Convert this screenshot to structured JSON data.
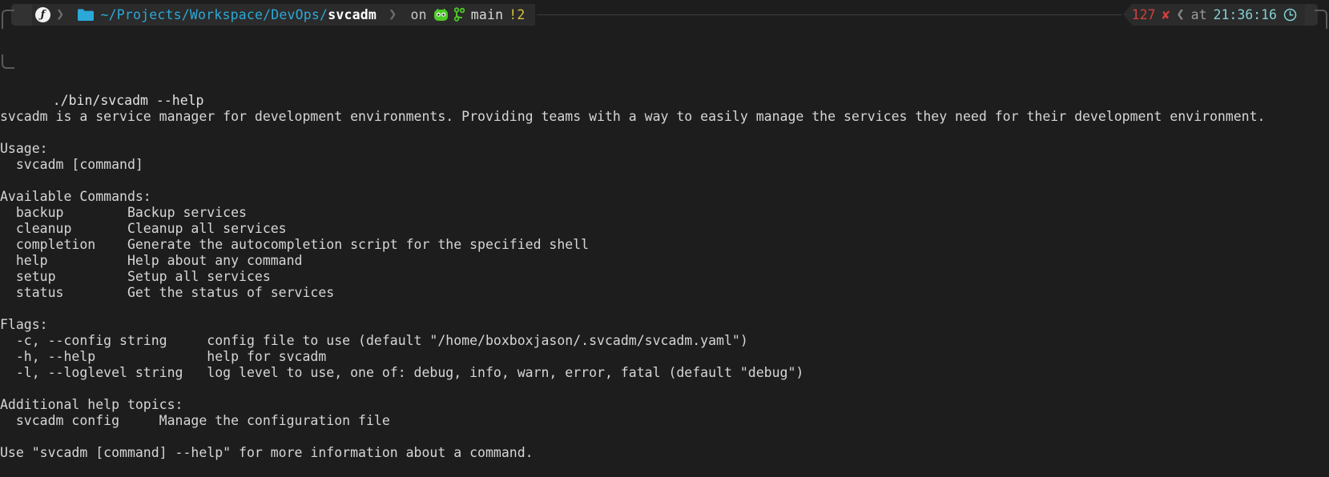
{
  "prompt": {
    "shell_icon": "fish-icon",
    "shell_glyph": "ƒ",
    "folder_icon": "folder-icon",
    "path_prefix": "~/Projects/Workspace/DevOps/",
    "path_current": "svcadm",
    "on_label": "on",
    "host_icon": "octocat-icon",
    "branch_icon": "git-branch-icon",
    "branch_name": "main",
    "git_status": "!2",
    "exit_code": "127",
    "exit_mark": "✘",
    "at_label": "at",
    "time": "21:36:16",
    "clock_icon": "clock-icon",
    "chevron": "❯",
    "chevron_left": "❮"
  },
  "terminal": {
    "command": "./bin/svcadm --help",
    "lines": [
      "svcadm is a service manager for development environments. Providing teams with a way to easily manage the services they need for their development environment.",
      "",
      "Usage:",
      "  svcadm [command]",
      "",
      "Available Commands:",
      "  backup        Backup services",
      "  cleanup       Cleanup all services",
      "  completion    Generate the autocompletion script for the specified shell",
      "  help          Help about any command",
      "  setup         Setup all services",
      "  status        Get the status of services",
      "",
      "Flags:",
      "  -c, --config string     config file to use (default \"/home/boxboxjason/.svcadm/svcadm.yaml\")",
      "  -h, --help              help for svcadm",
      "  -l, --loglevel string   log level to use, one of: debug, info, warn, error, fatal (default \"debug\")",
      "",
      "Additional help topics:",
      "  svcadm config     Manage the configuration file",
      "",
      "Use \"svcadm [command] --help\" for more information about a command."
    ]
  }
}
